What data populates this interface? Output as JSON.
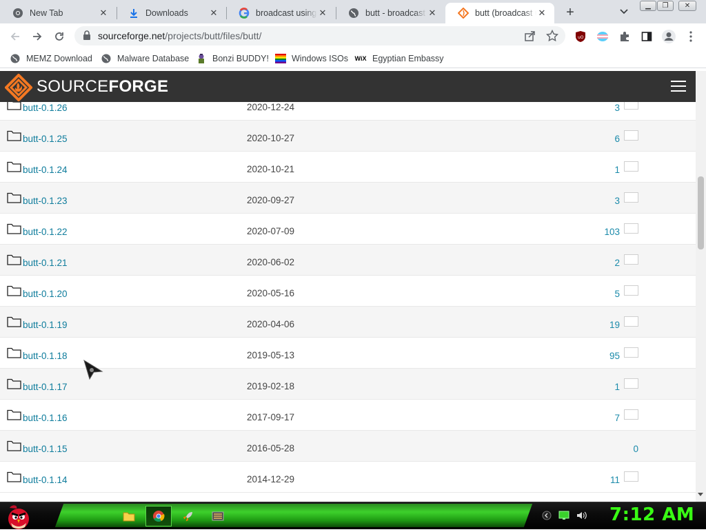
{
  "browser": {
    "tabs": [
      {
        "title": "New Tab",
        "icon": "chrome-icon",
        "active": false
      },
      {
        "title": "Downloads",
        "icon": "download-icon",
        "active": false
      },
      {
        "title": "broadcast using the",
        "icon": "google-icon",
        "active": false
      },
      {
        "title": "butt - broadcast us",
        "icon": "globe-icon",
        "active": false
      },
      {
        "title": "butt (broadcast us",
        "icon": "sourceforge-icon",
        "active": true
      }
    ],
    "url_domain": "sourceforge.net",
    "url_path": "/projects/butt/files/butt/",
    "bookmarks": [
      {
        "label": "MEMZ Download",
        "icon": "globe-icon"
      },
      {
        "label": "Malware Database",
        "icon": "globe-icon"
      },
      {
        "label": "Bonzi BUDDY!",
        "icon": "bonzi-icon"
      },
      {
        "label": "Windows ISOs",
        "icon": "windows-flag-icon"
      },
      {
        "label": "Egyptian Embassy",
        "icon": "wix-icon"
      }
    ]
  },
  "site": {
    "logo_part1": "SOURCE",
    "logo_part2": "FORGE",
    "brand_color": "#f47822",
    "link_color": "#0e7c9c"
  },
  "files": [
    {
      "name": "butt-0.1.26",
      "date": "2020-12-24",
      "downloads": "3",
      "chart": true
    },
    {
      "name": "butt-0.1.25",
      "date": "2020-10-27",
      "downloads": "6",
      "chart": true
    },
    {
      "name": "butt-0.1.24",
      "date": "2020-10-21",
      "downloads": "1",
      "chart": true
    },
    {
      "name": "butt-0.1.23",
      "date": "2020-09-27",
      "downloads": "3",
      "chart": true
    },
    {
      "name": "butt-0.1.22",
      "date": "2020-07-09",
      "downloads": "103",
      "chart": true
    },
    {
      "name": "butt-0.1.21",
      "date": "2020-06-02",
      "downloads": "2",
      "chart": true
    },
    {
      "name": "butt-0.1.20",
      "date": "2020-05-16",
      "downloads": "5",
      "chart": true
    },
    {
      "name": "butt-0.1.19",
      "date": "2020-04-06",
      "downloads": "19",
      "chart": true
    },
    {
      "name": "butt-0.1.18",
      "date": "2019-05-13",
      "downloads": "95",
      "chart": true
    },
    {
      "name": "butt-0.1.17",
      "date": "2019-02-18",
      "downloads": "1",
      "chart": true
    },
    {
      "name": "butt-0.1.16",
      "date": "2017-09-17",
      "downloads": "7",
      "chart": true
    },
    {
      "name": "butt-0.1.15",
      "date": "2016-05-28",
      "downloads": "0",
      "chart": false
    },
    {
      "name": "butt-0.1.14",
      "date": "2014-12-29",
      "downloads": "11",
      "chart": true
    }
  ],
  "taskbar": {
    "clock": "7:12 AM",
    "accent": "#39ff14",
    "apps": [
      "folder-icon",
      "chrome-icon",
      "rocket-icon",
      "media-icon"
    ]
  }
}
